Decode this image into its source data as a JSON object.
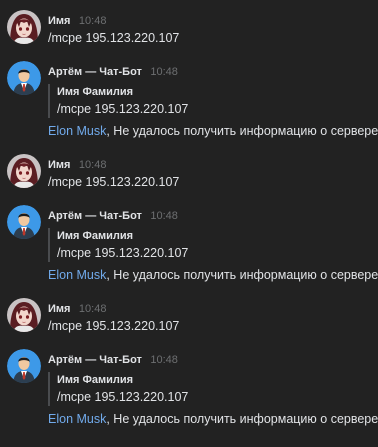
{
  "colors": {
    "background": "#222222",
    "text": "#e1e3e6",
    "muted": "#6d6f71",
    "mention": "#71aaeb",
    "quote_border": "#4a4c4f"
  },
  "messages": [
    {
      "kind": "user",
      "avatar_icon": "anime-girl-avatar-icon",
      "author": "Имя",
      "time": "10:48",
      "text": "/mcpe 195.123.220.107"
    },
    {
      "kind": "bot",
      "avatar_icon": "businessman-avatar-icon",
      "author": "Артём — Чат-Бот",
      "time": "10:48",
      "quote_author": "Имя Фамилия",
      "quote_text": "/mcpe 195.123.220.107",
      "mention": "Elon Musk",
      "reply_text": ", Не удалось получить информацию о сервере!"
    },
    {
      "kind": "user",
      "avatar_icon": "anime-girl-avatar-icon",
      "author": "Имя",
      "time": "10:48",
      "text": "/mcpe 195.123.220.107"
    },
    {
      "kind": "bot",
      "avatar_icon": "businessman-avatar-icon",
      "author": "Артём — Чат-Бот",
      "time": "10:48",
      "quote_author": "Имя Фамилия",
      "quote_text": "/mcpe 195.123.220.107",
      "mention": "Elon Musk",
      "reply_text": ", Не удалось получить информацию о сервере!"
    },
    {
      "kind": "user",
      "avatar_icon": "anime-girl-avatar-icon",
      "author": "Имя",
      "time": "10:48",
      "text": "/mcpe 195.123.220.107"
    },
    {
      "kind": "bot",
      "avatar_icon": "businessman-avatar-icon",
      "author": "Артём — Чат-Бот",
      "time": "10:48",
      "quote_author": "Имя Фамилия",
      "quote_text": "/mcpe 195.123.220.107",
      "mention": "Elon Musk",
      "reply_text": ", Не удалось получить информацию о сервере!"
    }
  ]
}
